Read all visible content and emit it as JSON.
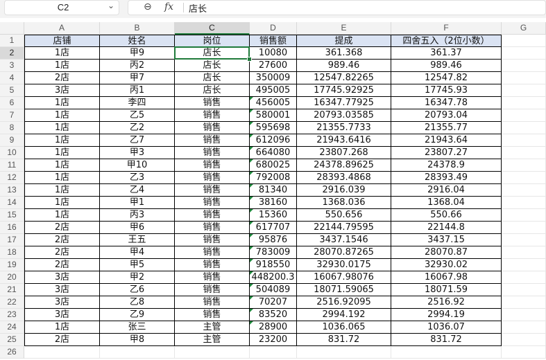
{
  "formula_bar": {
    "name_box": "C2",
    "chevron_icon": "chevron-down-icon",
    "zoom_icon": "zoom-icon",
    "fx_label": "fx",
    "formula": "店长"
  },
  "columns": [
    "A",
    "B",
    "C",
    "D",
    "E",
    "F",
    "G"
  ],
  "selected": {
    "column": "C",
    "row": 2
  },
  "table": {
    "headers": [
      "店铺",
      "姓名",
      "岗位",
      "销售额",
      "提成",
      "四舍五入（2位小数）"
    ],
    "rows": [
      [
        "1店",
        "甲9",
        "店长",
        "10080",
        "361.368",
        "361.37"
      ],
      [
        "1店",
        "丙2",
        "店长",
        "27600",
        "989.46",
        "989.46"
      ],
      [
        "2店",
        "甲7",
        "店长",
        "350009",
        "12547.82265",
        "12547.82"
      ],
      [
        "3店",
        "丙1",
        "店长",
        "495005",
        "17745.92925",
        "17745.93"
      ],
      [
        "1店",
        "李四",
        "销售",
        "456005",
        "16347.77925",
        "16347.78"
      ],
      [
        "1店",
        "乙5",
        "销售",
        "580001",
        "20793.03585",
        "20793.04"
      ],
      [
        "1店",
        "乙2",
        "销售",
        "595698",
        "21355.7733",
        "21355.77"
      ],
      [
        "1店",
        "乙7",
        "销售",
        "612096",
        "21943.6416",
        "21943.64"
      ],
      [
        "1店",
        "甲3",
        "销售",
        "664080",
        "23807.268",
        "23807.27"
      ],
      [
        "1店",
        "甲10",
        "销售",
        "680025",
        "24378.89625",
        "24378.9"
      ],
      [
        "1店",
        "乙3",
        "销售",
        "792008",
        "28393.4868",
        "28393.49"
      ],
      [
        "1店",
        "乙4",
        "销售",
        "81340",
        "2916.039",
        "2916.04"
      ],
      [
        "1店",
        "甲1",
        "销售",
        "38160",
        "1368.036",
        "1368.04"
      ],
      [
        "1店",
        "丙3",
        "销售",
        "15360",
        "550.656",
        "550.66"
      ],
      [
        "2店",
        "甲6",
        "销售",
        "617707",
        "22144.79595",
        "22144.8"
      ],
      [
        "2店",
        "王五",
        "销售",
        "95876",
        "3437.1546",
        "3437.15"
      ],
      [
        "2店",
        "甲4",
        "销售",
        "783009",
        "28070.87265",
        "28070.87"
      ],
      [
        "2店",
        "甲5",
        "销售",
        "918550",
        "32930.0175",
        "32930.02"
      ],
      [
        "3店",
        "甲2",
        "销售",
        "448200.3",
        "16067.98076",
        "16067.98"
      ],
      [
        "3店",
        "乙6",
        "销售",
        "504089",
        "18071.59065",
        "18071.59"
      ],
      [
        "3店",
        "乙8",
        "销售",
        "70207",
        "2516.92095",
        "2516.92"
      ],
      [
        "3店",
        "乙9",
        "销售",
        "83520",
        "2994.192",
        "2994.19"
      ],
      [
        "1店",
        "张三",
        "主管",
        "28900",
        "1036.065",
        "1036.07"
      ],
      [
        "2店",
        "甲8",
        "主管",
        "23200",
        "831.72",
        "831.72"
      ]
    ],
    "text_number_flag_rows": [
      6,
      7,
      8,
      9,
      10,
      11,
      12,
      13,
      14,
      15,
      16,
      17,
      18,
      19,
      20,
      21,
      22,
      23,
      24
    ]
  },
  "row_numbers": [
    "1",
    "2",
    "3",
    "4",
    "5",
    "6",
    "7",
    "8",
    "9",
    "10",
    "11",
    "12",
    "13",
    "14",
    "15",
    "16",
    "17",
    "18",
    "19",
    "20",
    "21",
    "22",
    "23",
    "24",
    "25",
    "26"
  ],
  "colors": {
    "header_fill": "#dae3f3",
    "selection": "#1f7a3a",
    "text_number_flag": "#1e8a3c"
  }
}
